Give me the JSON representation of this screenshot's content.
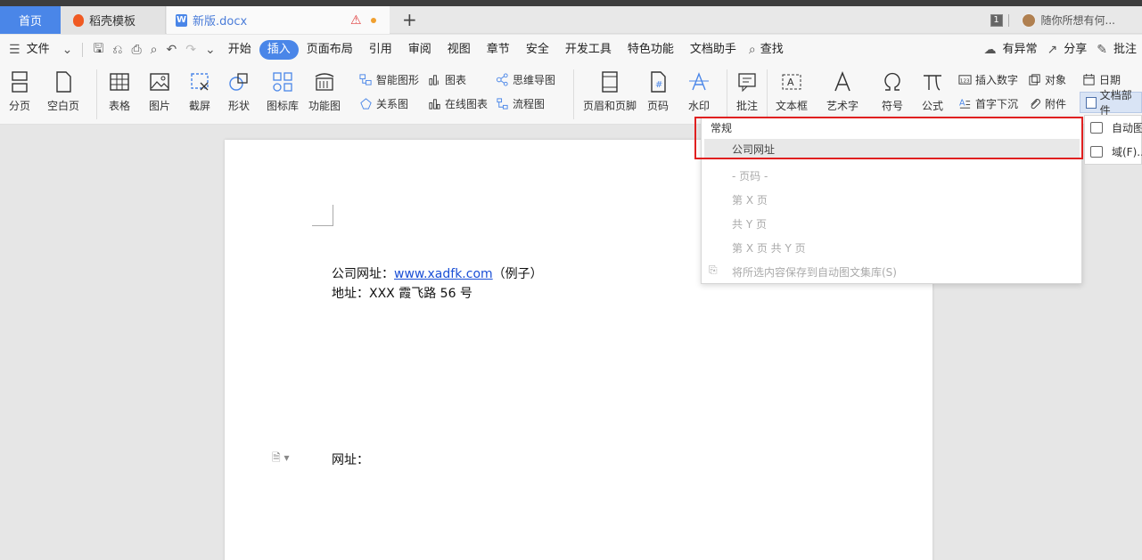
{
  "tabs": {
    "home": "首页",
    "template": "稻壳模板",
    "doc": "新版.docx",
    "tab_count": "1",
    "search_placeholder": "随你所想有何..."
  },
  "menu": {
    "file": "文件",
    "items": [
      "开始",
      "插入",
      "页面布局",
      "引用",
      "审阅",
      "视图",
      "章节",
      "安全",
      "开发工具",
      "特色功能",
      "文档助手"
    ],
    "active": "插入",
    "search": "查找",
    "right": [
      "有异常",
      "分享",
      "批注"
    ]
  },
  "ribbon": {
    "page_break": "分页",
    "blank_page": "空白页",
    "table": "表格",
    "picture": "图片",
    "screenshot": "截屏",
    "shape": "形状",
    "icon_lib": "图标库",
    "func_chart": "功能图",
    "smart_shape": "智能图形",
    "chart": "图表",
    "mind_map": "思维导图",
    "relation": "关系图",
    "online_chart": "在线图表",
    "flowchart": "流程图",
    "header_footer": "页眉和页脚",
    "page_num": "页码",
    "watermark": "水印",
    "comment": "批注",
    "textbox": "文本框",
    "wordart": "艺术字",
    "symbol": "符号",
    "formula": "公式",
    "insert_number": "插入数字",
    "object": "对象",
    "date": "日期",
    "drop_cap": "首字下沉",
    "attachment": "附件",
    "doc_parts": "文档部件"
  },
  "document": {
    "line1_prefix": "公司网址：",
    "line1_link": "www.xadfk.com",
    "line1_suffix": "（例子）",
    "line2": "地址：XXX 霞飞路 56 号",
    "line3": "网址："
  },
  "dropdown": {
    "heading": "常规",
    "items": [
      "公司网址",
      "- 页码 -",
      "第 X 页",
      "共 Y 页",
      "第 X 页 共 Y 页",
      "将所选内容保存到自动图文集库(S)"
    ]
  },
  "submenu": {
    "items": [
      "自动图",
      "域(F)..."
    ]
  }
}
